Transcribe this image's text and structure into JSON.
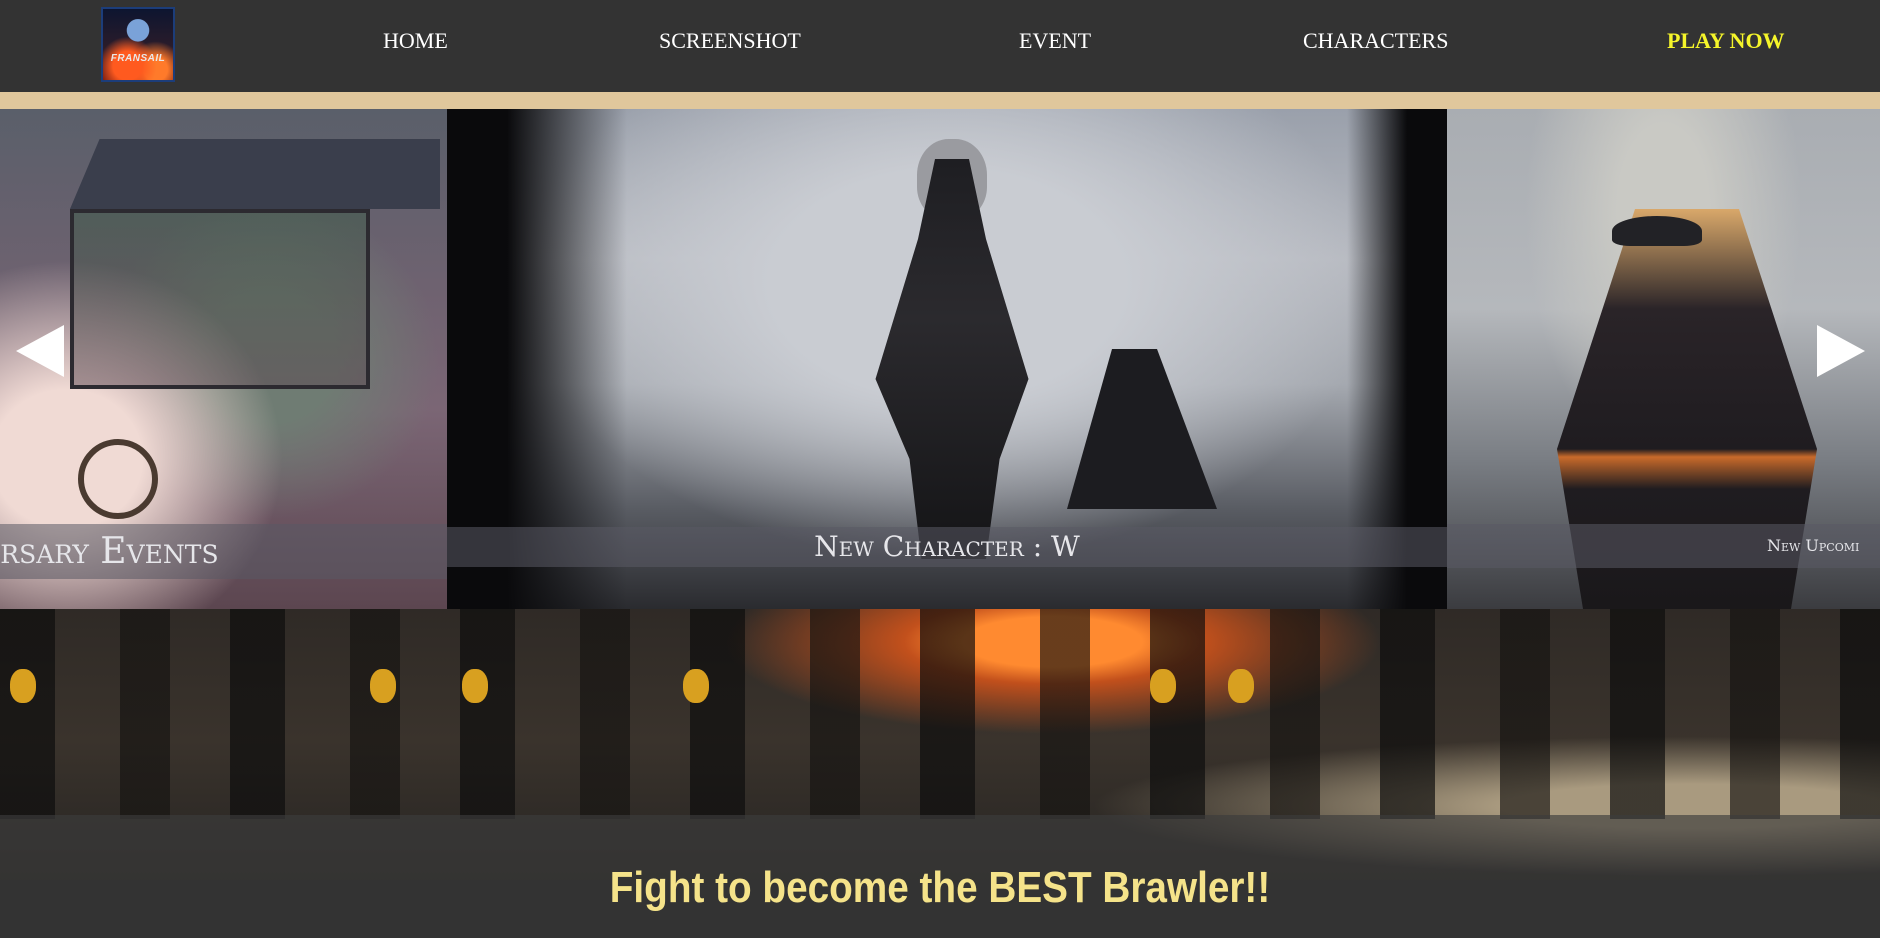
{
  "nav": {
    "logo_text": "FRANSAIL",
    "items": [
      {
        "label": "HOME"
      },
      {
        "label": "SCREENSHOT"
      },
      {
        "label": "EVENT"
      },
      {
        "label": "CHARACTERS"
      },
      {
        "label": "PLAY NOW",
        "color": "#f5f52a"
      }
    ]
  },
  "carousel": {
    "slides": [
      {
        "caption": "Anniversary Events",
        "visible_caption": "versary Events"
      },
      {
        "caption": "New Character : W"
      },
      {
        "caption": "New Upcoming",
        "visible_caption": "New Upcomi"
      }
    ],
    "prev_icon": "triangle-left-arrow",
    "next_icon": "triangle-right-arrow"
  },
  "banner": {
    "tagline": "Fight to become the BEST Brawler!!"
  },
  "colors": {
    "nav_bg": "#333333",
    "stripe": "#e0c79c",
    "tagline": "#f5e38a",
    "play_now": "#f5f52a"
  }
}
